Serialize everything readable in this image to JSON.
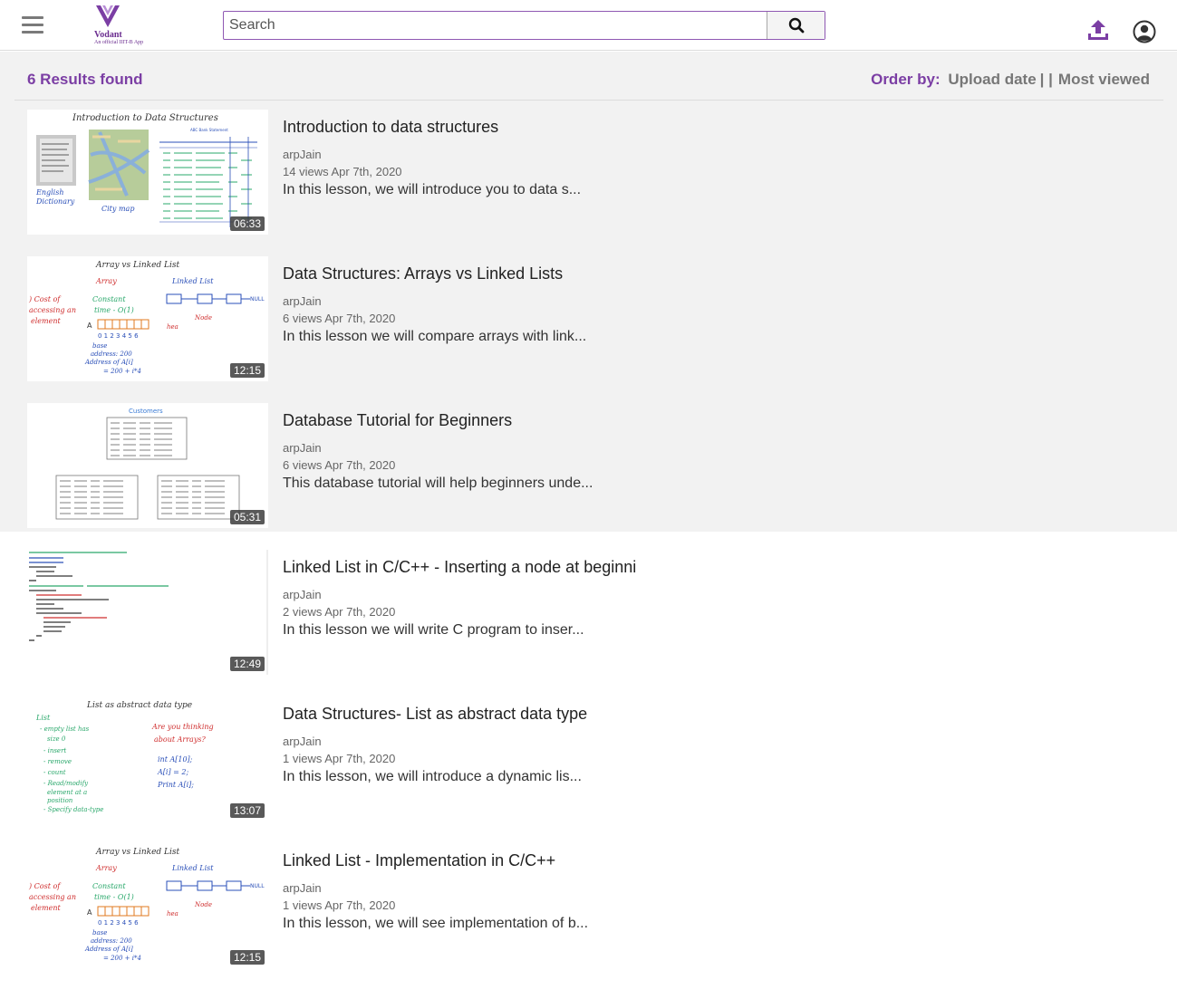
{
  "header": {
    "logo_name": "Vodant",
    "logo_tagline": "An official IIIT-B App",
    "search_placeholder": "Search",
    "colors": {
      "brand": "#7b3ea4",
      "border": "#8f58b3"
    }
  },
  "results": {
    "count_label": "6 Results found",
    "order_label": "Order by:",
    "order_options": [
      "Upload date",
      "Most viewed"
    ],
    "order_separator": "| |"
  },
  "videos": [
    {
      "title": "Introduction to data structures",
      "author": "arpJain",
      "views": "14 views",
      "date": "Apr 7th, 2020",
      "description": "In this lesson, we will introduce you to data s...",
      "duration": "06:33",
      "thumb_caption": "Introduction to Data Structures"
    },
    {
      "title": "Data Structures: Arrays vs Linked Lists",
      "author": "arpJain",
      "views": "6 views",
      "date": "Apr 7th, 2020",
      "description": "In this lesson we will compare arrays with link...",
      "duration": "12:15",
      "thumb_caption": "Array vs Linked List"
    },
    {
      "title": "Database Tutorial for Beginners",
      "author": "arpJain",
      "views": "6 views",
      "date": "Apr 7th, 2020",
      "description": "This database tutorial will help beginners unde...",
      "duration": "05:31",
      "thumb_caption": "Customers"
    },
    {
      "title": "Linked List in C/C++ - Inserting a node at beginni",
      "author": "arpJain",
      "views": "2 views",
      "date": "Apr 7th, 2020",
      "description": "In this lesson we will write C program to inser...",
      "duration": "12:49",
      "thumb_caption": ""
    },
    {
      "title": "Data Structures- List as abstract data type",
      "author": "arpJain",
      "views": "1 views",
      "date": "Apr 7th, 2020",
      "description": "In this lesson, we will introduce a dynamic lis...",
      "duration": "13:07",
      "thumb_caption": "List as abstract data type"
    },
    {
      "title": "Linked List - Implementation in C/C++",
      "author": "arpJain",
      "views": "1 views",
      "date": "Apr 7th, 2020",
      "description": "In this lesson, we will see implementation of b...",
      "duration": "12:15",
      "thumb_caption": "Array vs Linked List"
    }
  ]
}
